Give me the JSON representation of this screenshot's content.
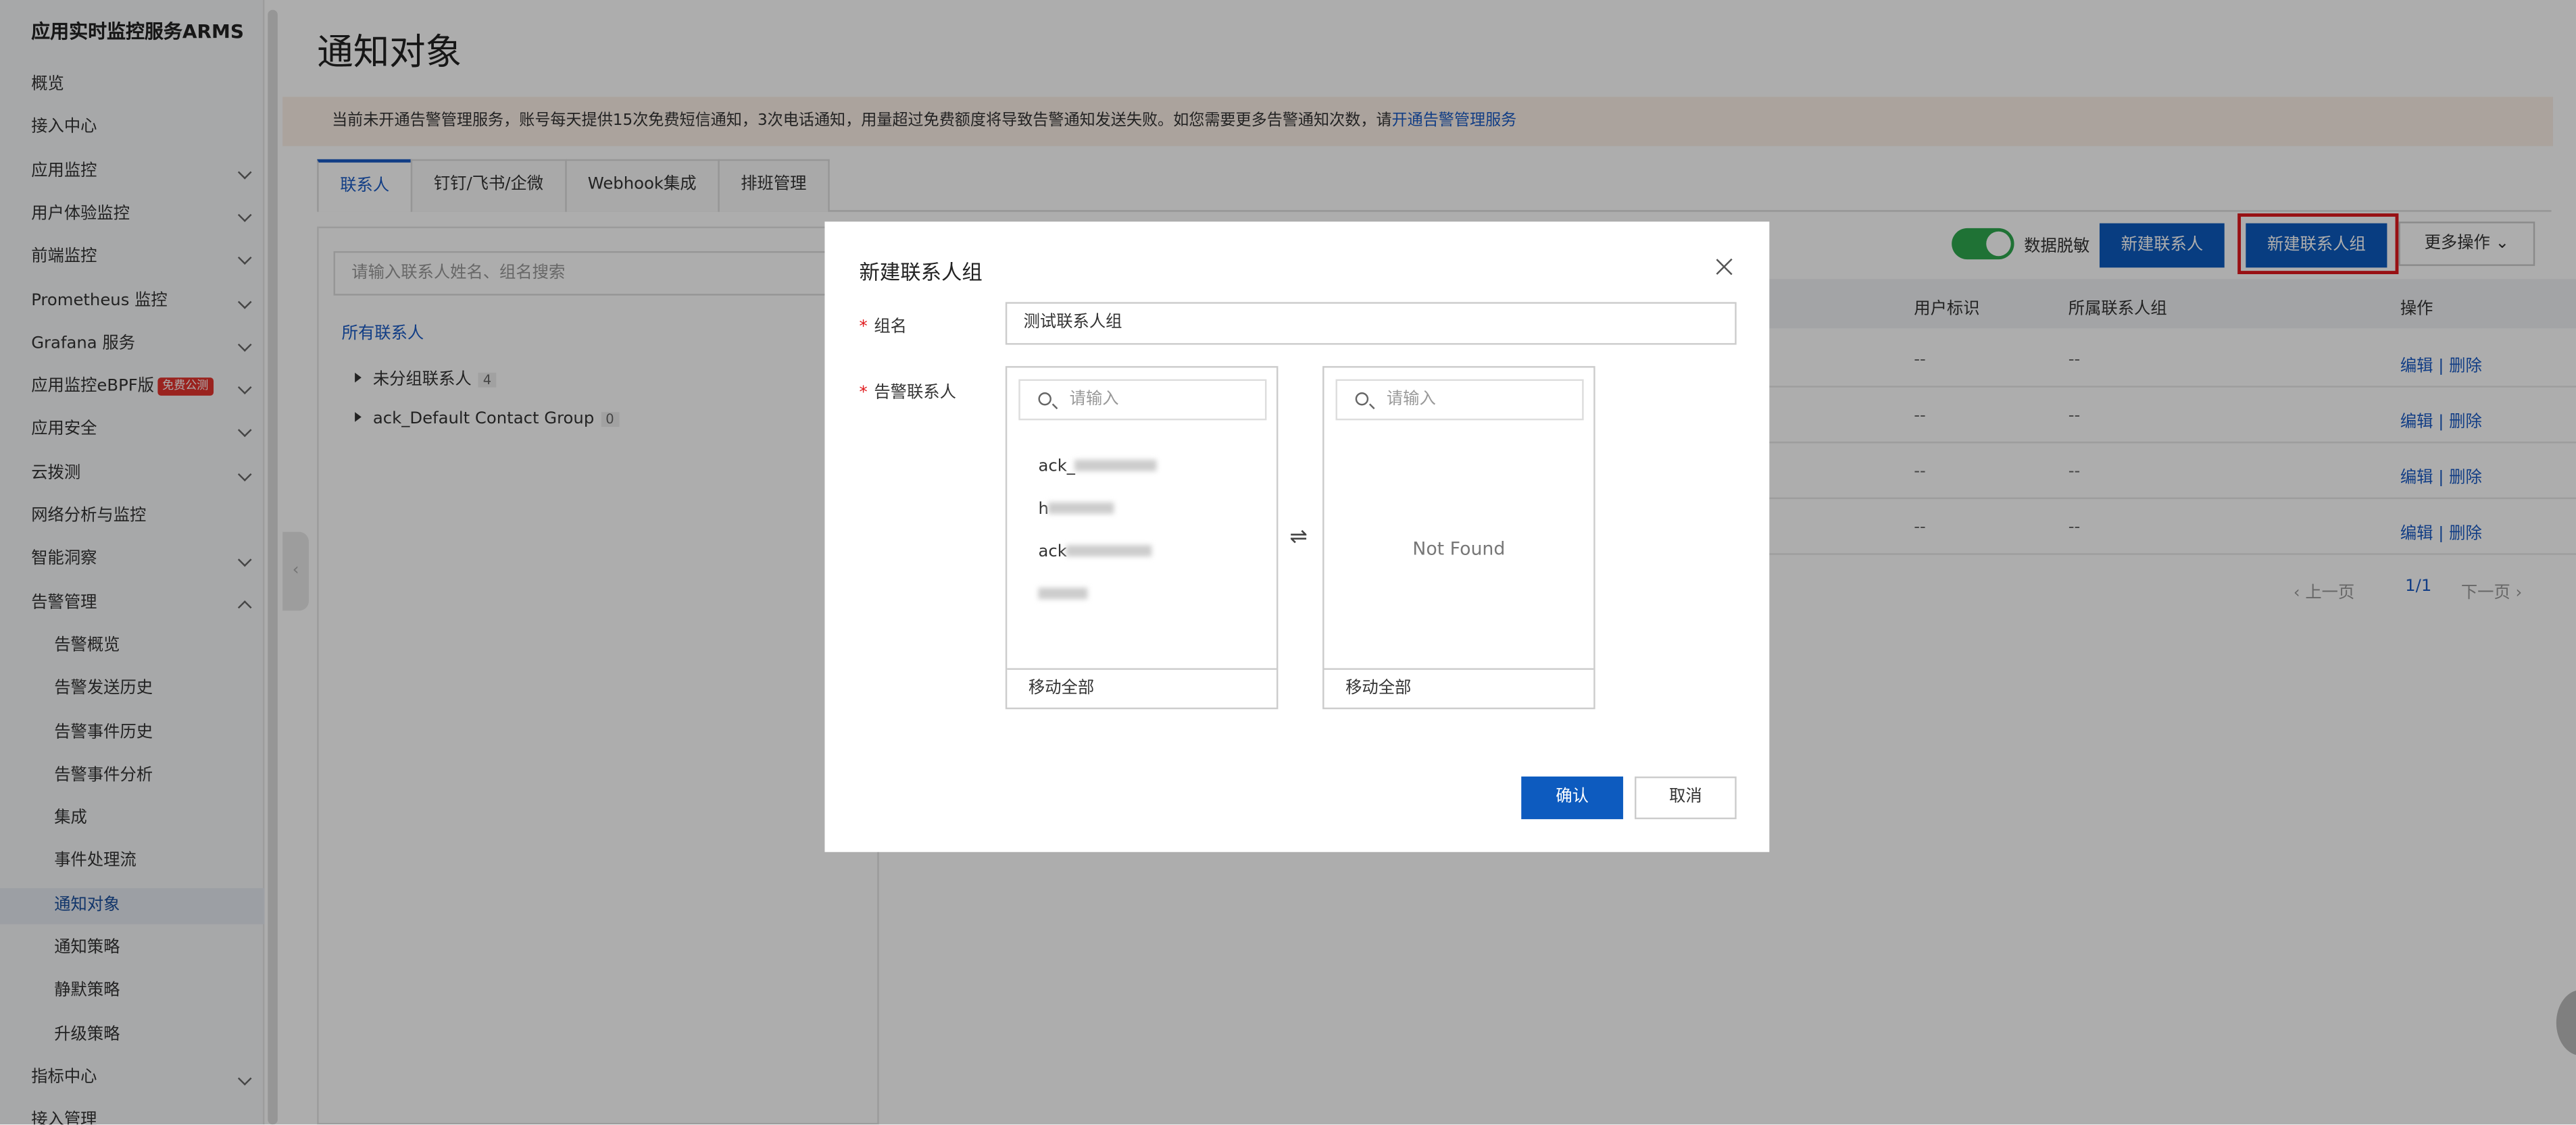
{
  "sidebar": {
    "title": "应用实时监控服务ARMS",
    "items": [
      {
        "label": "概览",
        "chevron": "none",
        "sub": false,
        "active": false
      },
      {
        "label": "接入中心",
        "chevron": "none",
        "sub": false,
        "active": false
      },
      {
        "label": "应用监控",
        "chevron": "down",
        "sub": false,
        "active": false
      },
      {
        "label": "用户体验监控",
        "chevron": "down",
        "sub": false,
        "active": false
      },
      {
        "label": "前端监控",
        "chevron": "down",
        "sub": false,
        "active": false
      },
      {
        "label": "Prometheus 监控",
        "chevron": "down",
        "sub": false,
        "active": false
      },
      {
        "label": "Grafana 服务",
        "chevron": "down",
        "sub": false,
        "active": false
      },
      {
        "label": "应用监控eBPF版",
        "badge": "免费公测",
        "chevron": "down",
        "sub": false,
        "active": false
      },
      {
        "label": "应用安全",
        "chevron": "down",
        "sub": false,
        "active": false
      },
      {
        "label": "云拨测",
        "chevron": "down",
        "sub": false,
        "active": false
      },
      {
        "label": "网络分析与监控",
        "chevron": "none",
        "sub": false,
        "active": false
      },
      {
        "label": "智能洞察",
        "chevron": "down",
        "sub": false,
        "active": false
      },
      {
        "label": "告警管理",
        "chevron": "up",
        "sub": false,
        "active": false
      },
      {
        "label": "告警概览",
        "chevron": "none",
        "sub": true,
        "active": false
      },
      {
        "label": "告警发送历史",
        "chevron": "none",
        "sub": true,
        "active": false
      },
      {
        "label": "告警事件历史",
        "chevron": "none",
        "sub": true,
        "active": false
      },
      {
        "label": "告警事件分析",
        "chevron": "none",
        "sub": true,
        "active": false
      },
      {
        "label": "集成",
        "chevron": "none",
        "sub": true,
        "active": false
      },
      {
        "label": "事件处理流",
        "chevron": "none",
        "sub": true,
        "active": false
      },
      {
        "label": "通知对象",
        "chevron": "none",
        "sub": true,
        "active": true
      },
      {
        "label": "通知策略",
        "chevron": "none",
        "sub": true,
        "active": false
      },
      {
        "label": "静默策略",
        "chevron": "none",
        "sub": true,
        "active": false
      },
      {
        "label": "升级策略",
        "chevron": "none",
        "sub": true,
        "active": false
      },
      {
        "label": "指标中心",
        "chevron": "down",
        "sub": false,
        "active": false
      },
      {
        "label": "接入管理",
        "chevron": "none",
        "sub": false,
        "active": false
      }
    ]
  },
  "page": {
    "title": "通知对象",
    "notice_text": "当前未开通告警管理服务，账号每天提供15次免费短信通知，3次电话通知，用量超过免费额度将导致告警通知发送失败。如您需要更多告警通知次数，请",
    "notice_link": "开通告警管理服务"
  },
  "tabs": [
    "联系人",
    "钉钉/飞书/企微",
    "Webhook集成",
    "排班管理"
  ],
  "left_panel": {
    "search_placeholder": "请输入联系人姓名、组名搜索",
    "all_label": "所有联系人",
    "groups": [
      {
        "name": "未分组联系人",
        "count": "4"
      },
      {
        "name": "ack_Default Contact Group",
        "count": "0"
      }
    ]
  },
  "toolbar": {
    "toggle_label": "数据脱敏",
    "new_contact": "新建联系人",
    "new_group": "新建联系人组",
    "more_actions": "更多操作"
  },
  "table": {
    "columns": [
      "用户标识",
      "所属联系人组",
      "操作"
    ],
    "rows": [
      {
        "user_id": "--",
        "group": "--",
        "edit": "编辑",
        "delete": "删除"
      },
      {
        "user_id": "--",
        "group": "--",
        "edit": "编辑",
        "delete": "删除"
      },
      {
        "user_id": "--",
        "group": "--",
        "edit": "编辑",
        "delete": "删除"
      },
      {
        "user_id": "--",
        "group": "--",
        "edit": "编辑",
        "delete": "删除"
      }
    ],
    "pager": {
      "prev": "上一页",
      "page": "1/1",
      "next": "下一页"
    }
  },
  "modal": {
    "title": "新建联系人组",
    "group_name_label": "组名",
    "group_name_value": "测试联系人组",
    "contacts_label": "告警联系人",
    "search_placeholder": "请输入",
    "source_items": [
      "ack_",
      "h",
      "ack",
      ""
    ],
    "target_empty": "Not Found",
    "move_all": "移动全部",
    "swap_icon": "⇌",
    "ok": "确认",
    "cancel": "取消"
  },
  "colors": {
    "primary": "#0d5bbf",
    "highlight": "#e0191c",
    "toggle_on": "#2fa84f"
  }
}
